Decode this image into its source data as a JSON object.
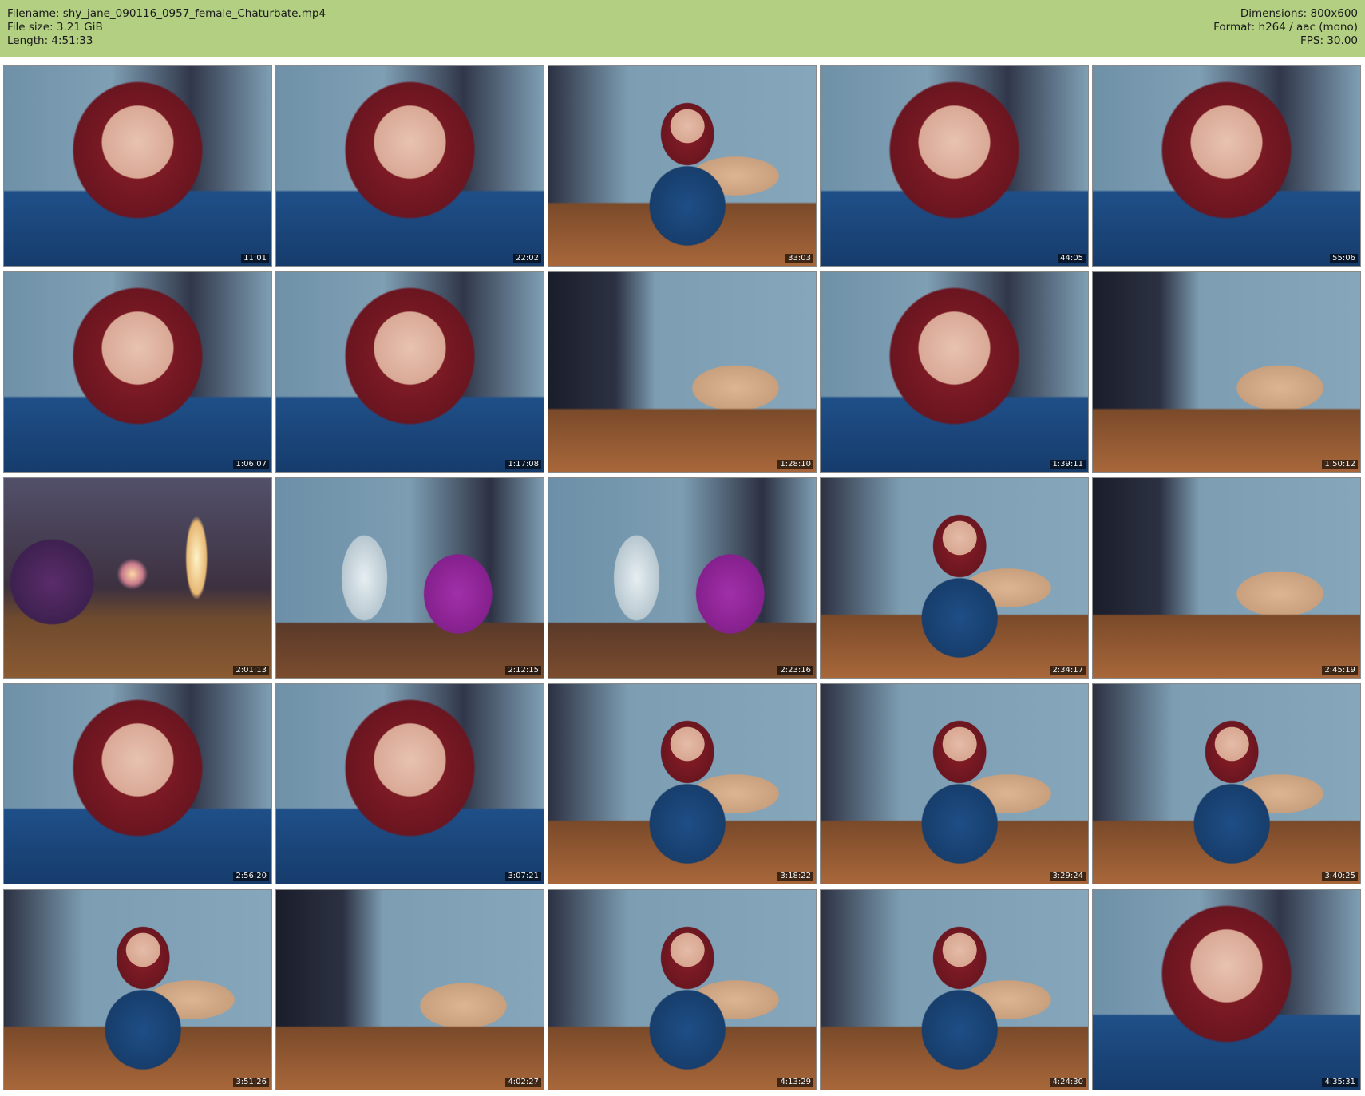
{
  "header": {
    "filename": "Filename: shy_jane_090116_0957_female_Chaturbate.mp4",
    "filesize": "File size: 3.21 GiB",
    "length": "Length: 4:51:33",
    "dimensions": "Dimensions: 800x600",
    "format": "Format: h264 / aac (mono)",
    "fps": "FPS: 30.00"
  },
  "thumbnails": [
    {
      "time": "11:01",
      "scene": "closeup"
    },
    {
      "time": "22:02",
      "scene": "closeup"
    },
    {
      "time": "33:03",
      "scene": "person"
    },
    {
      "time": "44:05",
      "scene": "closeup"
    },
    {
      "time": "55:06",
      "scene": "closeup"
    },
    {
      "time": "1:06:07",
      "scene": "closeup"
    },
    {
      "time": "1:17:08",
      "scene": "closeup"
    },
    {
      "time": "1:28:10",
      "scene": "room"
    },
    {
      "time": "1:39:11",
      "scene": "closeup"
    },
    {
      "time": "1:50:12",
      "scene": "room"
    },
    {
      "time": "2:01:13",
      "scene": "blur"
    },
    {
      "time": "2:12:15",
      "scene": "chair"
    },
    {
      "time": "2:23:16",
      "scene": "chair"
    },
    {
      "time": "2:34:17",
      "scene": "person"
    },
    {
      "time": "2:45:19",
      "scene": "room"
    },
    {
      "time": "2:56:20",
      "scene": "closeup"
    },
    {
      "time": "3:07:21",
      "scene": "closeup"
    },
    {
      "time": "3:18:22",
      "scene": "person"
    },
    {
      "time": "3:29:24",
      "scene": "person"
    },
    {
      "time": "3:40:25",
      "scene": "person"
    },
    {
      "time": "3:51:26",
      "scene": "person"
    },
    {
      "time": "4:02:27",
      "scene": "room"
    },
    {
      "time": "4:13:29",
      "scene": "person"
    },
    {
      "time": "4:24:30",
      "scene": "person"
    },
    {
      "time": "4:35:31",
      "scene": "closeup"
    }
  ]
}
